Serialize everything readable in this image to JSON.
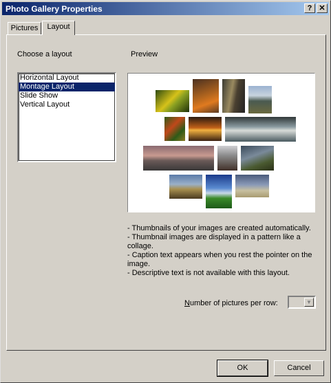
{
  "window": {
    "title": "Photo Gallery Properties",
    "help_label": "?",
    "close_label": "✕"
  },
  "tabs": [
    {
      "label": "Pictures"
    },
    {
      "label": "Layout"
    }
  ],
  "layout_section": {
    "label": "Choose a layout"
  },
  "layouts": [
    {
      "label": "Horizontal Layout",
      "selected": false
    },
    {
      "label": "Montage Layout",
      "selected": true
    },
    {
      "label": "Slide Show",
      "selected": false
    },
    {
      "label": "Vertical Layout",
      "selected": false
    }
  ],
  "preview": {
    "label": "Preview"
  },
  "description": [
    "- Thumbnails of your images are created automatically.",
    "- Thumbnail images are displayed in a pattern like a collage.",
    "- Caption text appears when you rest the pointer on the image.",
    "- Descriptive text is not available with this layout."
  ],
  "pictures_per_row": {
    "label_prefix": "N",
    "label_rest": "umber of pictures per row:",
    "value": ""
  },
  "buttons": {
    "ok": "OK",
    "cancel": "Cancel"
  },
  "colors": {
    "titlebar_start": "#0a246a",
    "titlebar_end": "#a6caf0",
    "selection": "#0a246a",
    "face": "#d4d0c8"
  }
}
